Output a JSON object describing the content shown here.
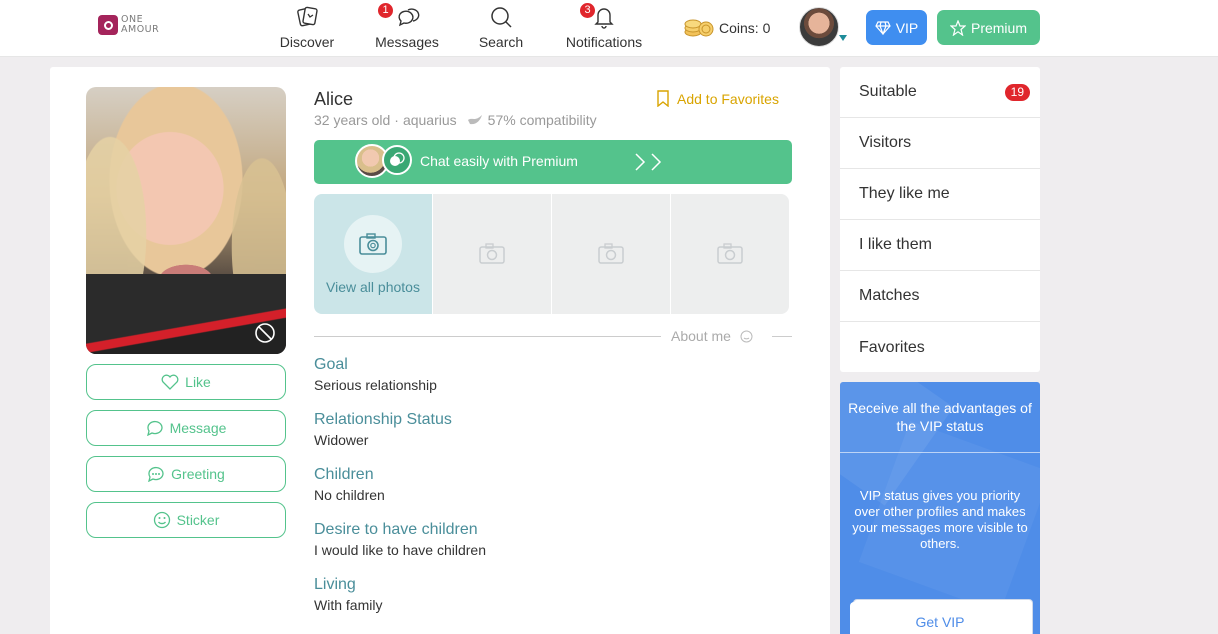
{
  "header": {
    "logo_text_line1": "ONE",
    "logo_text_line2": "AMOUR",
    "nav": [
      {
        "label": "Discover",
        "icon": "cards-icon",
        "badge": null
      },
      {
        "label": "Messages",
        "icon": "chat-bubbles-icon",
        "badge": "1"
      },
      {
        "label": "Search",
        "icon": "search-icon",
        "badge": null
      },
      {
        "label": "Notifications",
        "icon": "bell-icon",
        "badge": "3"
      }
    ],
    "coins_label": "Coins: 0",
    "vip_label": "VIP",
    "premium_label": "Premium"
  },
  "profile": {
    "name": "Alice",
    "age": "32 years old",
    "sign": "aquarius",
    "compatibility": "57% compatibility",
    "favorites_label": "Add to Favorites",
    "actions": {
      "like": "Like",
      "message": "Message",
      "greeting": "Greeting",
      "sticker": "Sticker"
    },
    "premium_banner": "Chat easily with Premium",
    "view_all_photos": "View all photos",
    "about_me": "About me",
    "info": [
      {
        "title": "Goal",
        "value": "Serious relationship"
      },
      {
        "title": "Relationship Status",
        "value": "Widower"
      },
      {
        "title": "Children",
        "value": "No children"
      },
      {
        "title": "Desire to have children",
        "value": "I would like to have children"
      },
      {
        "title": "Living",
        "value": "With family"
      }
    ]
  },
  "sidebar": {
    "items": [
      {
        "label": "Suitable",
        "badge": "19"
      },
      {
        "label": "Visitors"
      },
      {
        "label": "They like me"
      },
      {
        "label": "I like them"
      },
      {
        "label": "Matches"
      },
      {
        "label": "Favorites"
      }
    ],
    "vip_card": {
      "heading": "Receive all the advantages of the VIP status",
      "body": "VIP status gives you priority over other profiles and makes your messages more visible to others.",
      "button": "Get VIP"
    }
  },
  "colors": {
    "accent_green": "#54c38c",
    "vip_blue": "#3f8ef0",
    "badge_red": "#e0262c",
    "teal_text": "#4a8e9a",
    "favorite_gold": "#d9a400"
  }
}
